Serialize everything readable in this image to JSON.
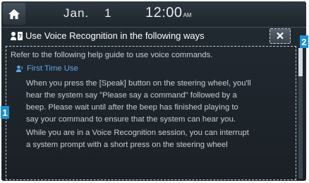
{
  "status_bar": {
    "home_icon": "home-icon",
    "date_month": "Jan.",
    "date_day": "1",
    "time": "12:00",
    "ampm": "AM"
  },
  "header": {
    "icon": "voice-recognition-help-icon",
    "title": "Use Voice Recognition in the following ways",
    "close_label": "✕"
  },
  "content": {
    "intro": "Refer to the following help guide to use voice commands.",
    "section_title": "First Time Use",
    "section_icon": "voice-icon",
    "paragraph1_lines": [
      "When you press the [Speak] button on the steering wheel, you'll",
      "hear the system say \"Please say a command\" followed by a",
      "beep. Please wait until after the beep has finished playing to",
      "say your command to ensure that the system can hear you."
    ],
    "paragraph2_lines": [
      "While you are in a Voice Recognition session, you can interrupt",
      "a system prompt with a short press on the steering wheel"
    ]
  },
  "callouts": {
    "marker_1": "1",
    "marker_2": "2"
  },
  "colors": {
    "accent": "#1f8fd4",
    "section_title": "#5aa8e8",
    "background": "#1e252c",
    "text": "#c8ced3"
  }
}
